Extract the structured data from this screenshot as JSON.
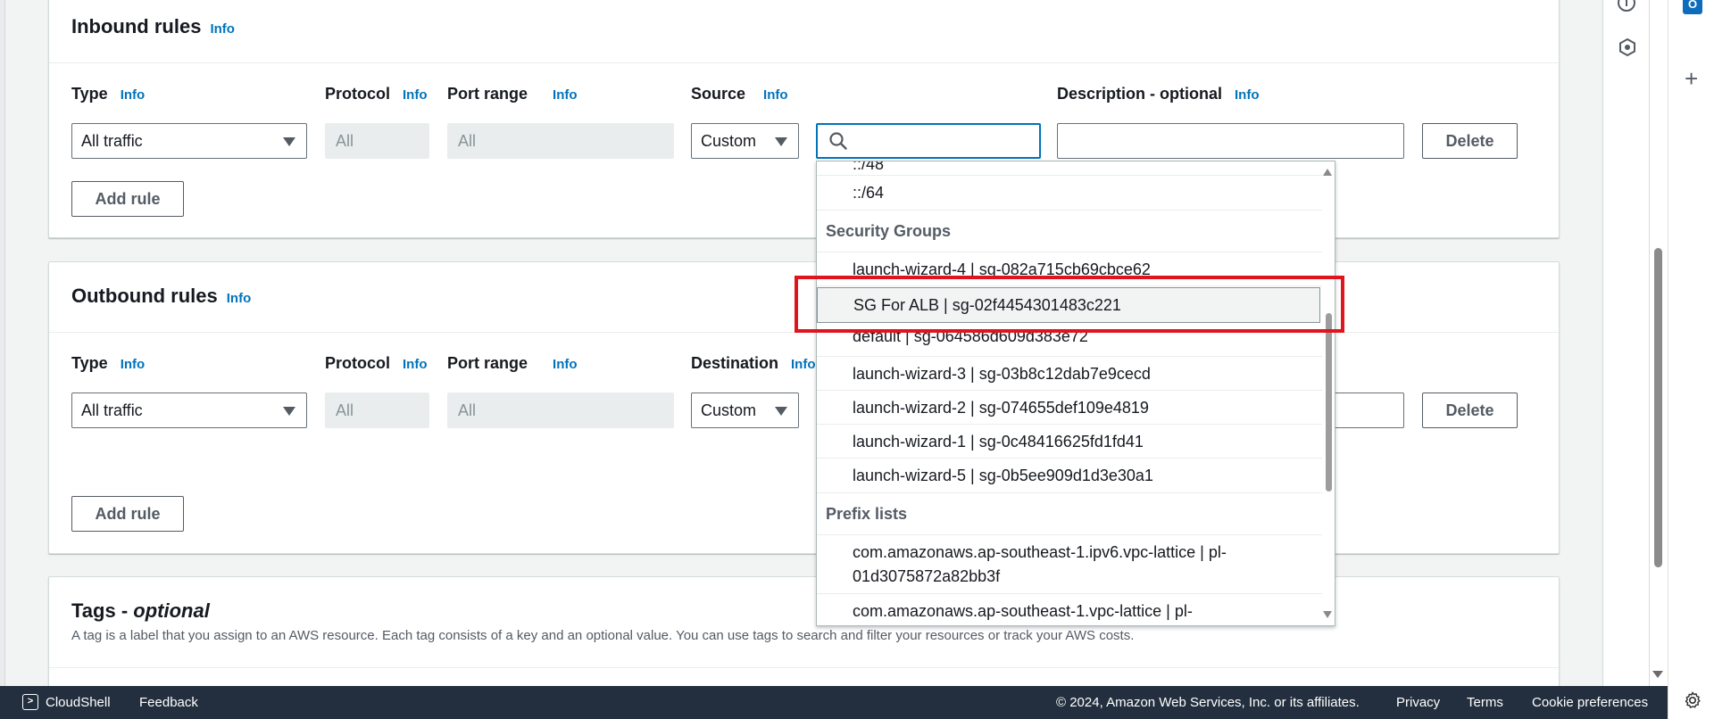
{
  "inbound": {
    "title": "Inbound rules",
    "info": "Info",
    "labels": {
      "type": "Type",
      "protocol": "Protocol",
      "port_range": "Port range",
      "source": "Source",
      "description": "Description - optional"
    },
    "type_value": "All traffic",
    "protocol_value": "All",
    "port_value": "All",
    "source_value": "Custom",
    "search_value": "",
    "delete_label": "Delete",
    "add_rule_label": "Add rule"
  },
  "outbound": {
    "title": "Outbound rules",
    "info": "Info",
    "labels": {
      "type": "Type",
      "protocol": "Protocol",
      "port_range": "Port range",
      "destination": "Destination"
    },
    "type_value": "All traffic",
    "protocol_value": "All",
    "port_value": "All",
    "destination_value": "Custom",
    "delete_label": "Delete",
    "add_rule_label": "Add rule"
  },
  "tags": {
    "title_prefix": "Tags - ",
    "title_italic": "optional",
    "description": "A tag is a label that you assign to an AWS resource. Each tag consists of a key and an optional value. You can use tags to search and filter your resources or track your AWS costs."
  },
  "dropdown": {
    "cidr_items": [
      "::/48",
      "::/64"
    ],
    "security_groups_label": "Security Groups",
    "security_groups": [
      "launch-wizard-4 | sg-082a715cb69cbce62",
      "SG For ALB | sg-02f4454301483c221",
      "default | sg-064586d609d383e72",
      "launch-wizard-3 | sg-03b8c12dab7e9cecd",
      "launch-wizard-2 | sg-074655def109e4819",
      "launch-wizard-1 | sg-0c48416625fd1fd41",
      "launch-wizard-5 | sg-0b5ee909d1d3e30a1"
    ],
    "prefix_lists_label": "Prefix lists",
    "prefix_lists": [
      "com.amazonaws.ap-southeast-1.ipv6.vpc-lattice | pl-01d3075872a82bb3f",
      "com.amazonaws.ap-southeast-1.vpc-lattice | pl-"
    ]
  },
  "footer": {
    "cloudshell": "CloudShell",
    "feedback": "Feedback",
    "copyright": "© 2024, Amazon Web Services, Inc. or its affiliates.",
    "privacy": "Privacy",
    "terms": "Terms",
    "cookie": "Cookie preferences"
  },
  "icons": {
    "search": "search-icon",
    "settings": "gear-icon"
  }
}
